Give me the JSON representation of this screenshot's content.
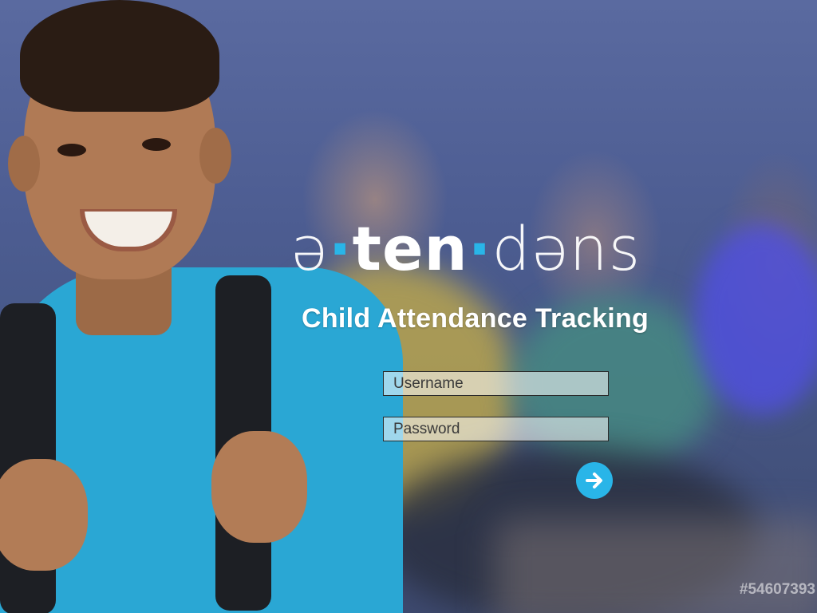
{
  "brand": {
    "wordmark": {
      "part1": "ə",
      "dot1": "·",
      "part2": "ten",
      "dot2": "·",
      "part3": "dəns"
    },
    "tagline": "Child Attendance Tracking",
    "accent_color": "#29b5e8"
  },
  "login": {
    "username_placeholder": "Username",
    "password_placeholder": "Password",
    "submit_icon": "arrow-right-icon"
  },
  "background": {
    "watermark_text": "#54607393"
  }
}
